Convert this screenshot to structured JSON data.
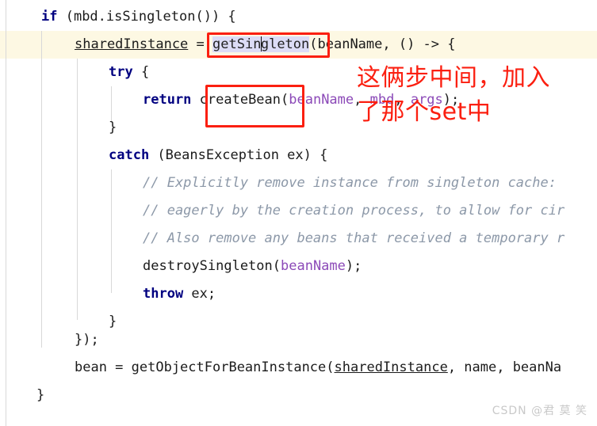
{
  "editor": {
    "language": "java",
    "current_line_index": 1,
    "theme": {
      "background": "#ffffff",
      "current_line_highlight": "#fdf8e3",
      "selection": "#dcdcf6",
      "keyword": "#000080",
      "text": "#1b1b1b",
      "parameter": "#8c4ab8",
      "comment": "#8c98a8",
      "indent_guide": "#d8d8d8",
      "annotation_red": "#fb1f10",
      "watermark": "#c9c9c9"
    },
    "lines": [
      {
        "indent": 3,
        "text": "if (mbd.isSingleton()) {"
      },
      {
        "indent": 5,
        "text": "sharedInstance = getSingleton(beanName, () -> {"
      },
      {
        "indent": 8,
        "text": "try {"
      },
      {
        "indent": 11,
        "text": "return createBean(beanName, mbd, args);"
      },
      {
        "indent": 8,
        "text": "}"
      },
      {
        "indent": 8,
        "text": "catch (BeansException ex) {"
      },
      {
        "indent": 11,
        "text": "// Explicitly remove instance from singleton cache:"
      },
      {
        "indent": 11,
        "text": "// eagerly by the creation process, to allow for cir"
      },
      {
        "indent": 11,
        "text": "// Also remove any beans that received a temporary r"
      },
      {
        "indent": 11,
        "text": "destroySingleton(beanName);"
      },
      {
        "indent": 11,
        "text": "throw ex;"
      },
      {
        "indent": 8,
        "text": "}"
      },
      {
        "indent": 5,
        "text": "});"
      },
      {
        "indent": 5,
        "text": "bean = getObjectForBeanInstance(sharedInstance, name, beanNa"
      },
      {
        "indent": 2,
        "text": "}"
      }
    ],
    "tokens": {
      "line0": {
        "keyword": "if",
        "rest": " (mbd.isSingleton()) {"
      },
      "line1": {
        "field": "sharedInstance",
        "eq": " = ",
        "selected_before_caret": "getSin",
        "selected_after_caret": "gleton",
        "rest": "(beanName, () -> {"
      },
      "line2": {
        "keyword": "try",
        "rest": " {"
      },
      "line3": {
        "keyword": "return",
        "call": " createBean(",
        "param1": "beanName",
        "sep1": ", ",
        "param2": "mbd",
        "sep2": ", ",
        "param3": "args",
        "rest": ");"
      },
      "line4": {
        "text": "}"
      },
      "line5": {
        "keyword": "catch",
        "rest": " (BeansException ex) {"
      },
      "line6": {
        "comment": "// Explicitly remove instance from singleton cache:"
      },
      "line7": {
        "comment": "// eagerly by the creation process, to allow for cir"
      },
      "line8": {
        "comment": "// Also remove any beans that received a temporary r"
      },
      "line9": {
        "call": "destroySingleton(",
        "param1": "beanName",
        "rest": ");"
      },
      "line10": {
        "keyword": "throw",
        "rest": " ex;"
      },
      "line11": {
        "text": "}"
      },
      "line12": {
        "text": "});"
      },
      "line13": {
        "prefix": "bean = getObjectForBeanInstance(",
        "field": "sharedInstance",
        "rest": ", name, beanNa"
      },
      "line14": {
        "text": "}"
      }
    }
  },
  "annotations": {
    "boxes": [
      {
        "name": "getSingleton-highlight-box",
        "label": "getSingleton"
      },
      {
        "name": "createBean-highlight-box",
        "label": "createBean("
      }
    ],
    "note_line1": "这俩步中间，加入",
    "note_line2": "了那个set中"
  },
  "watermark": {
    "text": "CSDN @君 莫 笑"
  }
}
